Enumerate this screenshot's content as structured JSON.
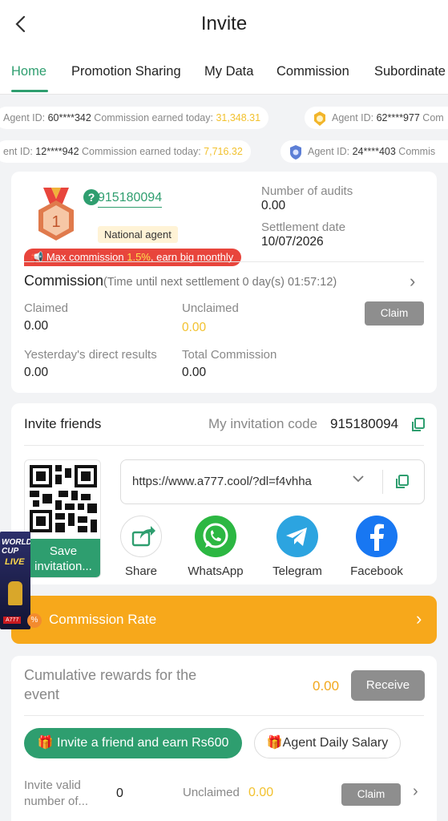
{
  "header": {
    "title": "Invite"
  },
  "tabs": [
    {
      "label": "Home"
    },
    {
      "label": "Promotion Sharing"
    },
    {
      "label": "My Data"
    },
    {
      "label": "Commission"
    },
    {
      "label": "Subordinate"
    }
  ],
  "tickers": [
    {
      "prefix": "Agent ID: ",
      "id": "60****342",
      "text": " Commission earned today: ",
      "amount": "31,348.31"
    },
    {
      "prefix": "Agent ID: ",
      "id": "62****977",
      "text": " Com",
      "amount": ""
    },
    {
      "prefix": "ent ID: ",
      "id": "12****942",
      "text": " Commission earned today: ",
      "amount": "7,716.32"
    },
    {
      "prefix": "Agent ID: ",
      "id": "24****403",
      "text": " Commis",
      "amount": ""
    }
  ],
  "agent": {
    "rank_number": "1",
    "user_id": "915180094",
    "rank_label": "National agent",
    "audits_label": "Number of audits",
    "audits_value": "0.00",
    "settlement_label": "Settlement date",
    "settlement_value": "10/07/2026",
    "banner_prefix": "Max commission ",
    "banner_pct": "1.5%",
    "banner_suffix": ", earn big monthly"
  },
  "commission": {
    "title": "Commission",
    "subtitle": "(Time until next settlement  0 day(s) 01:57:12)",
    "claimed_label": "Claimed",
    "claimed_value": "0.00",
    "unclaimed_label": "Unclaimed",
    "unclaimed_value": "0.00",
    "claim_button": "Claim",
    "yesterday_label": "Yesterday's direct results",
    "yesterday_value": "0.00",
    "total_label": "Total Commission",
    "total_value": "0.00"
  },
  "invite": {
    "title": "Invite friends",
    "code_label": "My invitation code",
    "code_value": "915180094",
    "save_label": "Save invitation...",
    "url": "https://www.a777.cool/?dl=f4vhha",
    "share_items": [
      {
        "label": "Share"
      },
      {
        "label": "WhatsApp"
      },
      {
        "label": "Telegram"
      },
      {
        "label": "Facebook"
      }
    ]
  },
  "commission_rate": {
    "label": "Commission Rate"
  },
  "rewards": {
    "title": "Cumulative rewards for the event",
    "amount": "0.00",
    "receive_button": "Receive",
    "invite_button": "Invite a friend and earn Rs600",
    "salary_button": "Agent Daily Salary",
    "valid_label": "Invite valid number of...",
    "valid_value": "0",
    "unclaimed_label": "Unclaimed",
    "unclaimed_value": "0.00",
    "claim_button": "Claim"
  },
  "float_ad": {
    "line1": "WORLD CUP",
    "line2": "LIVE",
    "brand": "A777",
    "badge": "%"
  },
  "colors": {
    "accent": "#2e9e6f",
    "orange": "#f7a81b",
    "gold": "#f2c12e",
    "red": "#e8453c"
  }
}
